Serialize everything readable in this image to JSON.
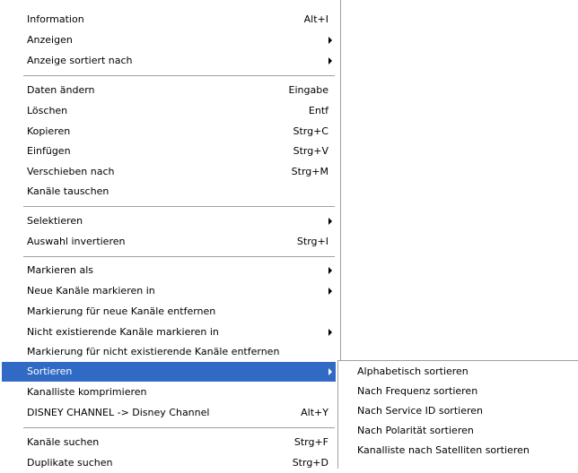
{
  "main_menu": {
    "items": [
      {
        "label": "Information",
        "shortcut": "Alt+I"
      },
      {
        "label": "Anzeigen",
        "submenu": true
      },
      {
        "label": "Anzeige sortiert nach",
        "submenu": true
      },
      {
        "label": "Daten ändern",
        "shortcut": "Eingabe"
      },
      {
        "label": "Löschen",
        "shortcut": "Entf"
      },
      {
        "label": "Kopieren",
        "shortcut": "Strg+C"
      },
      {
        "label": "Einfügen",
        "shortcut": "Strg+V"
      },
      {
        "label": "Verschieben nach",
        "shortcut": "Strg+M"
      },
      {
        "label": "Kanäle tauschen"
      },
      {
        "label": "Selektieren",
        "submenu": true
      },
      {
        "label": "Auswahl invertieren",
        "shortcut": "Strg+I"
      },
      {
        "label": "Markieren als",
        "submenu": true
      },
      {
        "label": "Neue Kanäle markieren in",
        "submenu": true
      },
      {
        "label": "Markierung für neue Kanäle entfernen"
      },
      {
        "label": "Nicht existierende Kanäle markieren in",
        "submenu": true
      },
      {
        "label": "Markierung für nicht existierende Kanäle entfernen"
      },
      {
        "label": "Sortieren",
        "submenu": true,
        "highlighted": true
      },
      {
        "label": "Kanalliste komprimieren"
      },
      {
        "label": "DISNEY CHANNEL -> Disney Channel",
        "shortcut": "Alt+Y"
      },
      {
        "label": "Kanäle suchen",
        "shortcut": "Strg+F"
      },
      {
        "label": "Duplikate suchen",
        "shortcut": "Strg+D"
      }
    ]
  },
  "sort_submenu": {
    "items": [
      {
        "label": "Alphabetisch sortieren"
      },
      {
        "label": "Nach Frequenz sortieren"
      },
      {
        "label": "Nach Service ID sortieren"
      },
      {
        "label": "Nach Polarität sortieren"
      },
      {
        "label": "Kanalliste nach Satelliten sortieren"
      }
    ]
  },
  "colors": {
    "highlight": "#316ac5",
    "separator": "#a0a0a0"
  }
}
